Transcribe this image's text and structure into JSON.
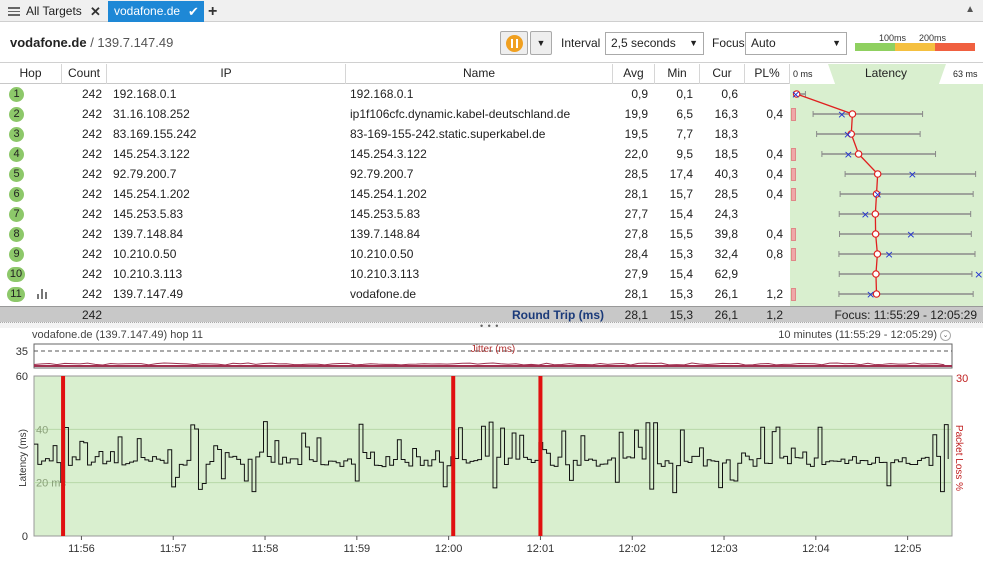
{
  "tabs": [
    {
      "label": "All Targets",
      "active": false
    },
    {
      "label": "vodafone.de",
      "active": true
    }
  ],
  "toolbar": {
    "host": "vodafone.de",
    "ip": "/ 139.7.147.49",
    "interval_label": "Interval",
    "interval_value": "2,5 seconds",
    "focus_label": "Focus",
    "focus_value": "Auto",
    "legend": [
      "100ms",
      "200ms"
    ],
    "colors": {
      "good": "#8fd060",
      "warn": "#f5c040",
      "bad": "#f06040"
    }
  },
  "table": {
    "headers": [
      "Hop",
      "Count",
      "IP",
      "Name",
      "Avg",
      "Min",
      "Cur",
      "PL%",
      "Latency"
    ],
    "latency_range": [
      "0 ms",
      "63 ms"
    ],
    "rows": [
      {
        "hop": "1",
        "count": "242",
        "ip": "192.168.0.1",
        "name": "192.168.0.1",
        "avg": "0,9",
        "min": "0,1",
        "cur": "0,6",
        "pl": ""
      },
      {
        "hop": "2",
        "count": "242",
        "ip": "31.16.108.252",
        "name": "ip1f106cfc.dynamic.kabel-deutschland.de",
        "avg": "19,9",
        "min": "6,5",
        "cur": "16,3",
        "pl": "0,4"
      },
      {
        "hop": "3",
        "count": "242",
        "ip": "83.169.155.242",
        "name": "83-169-155-242.static.superkabel.de",
        "avg": "19,5",
        "min": "7,7",
        "cur": "18,3",
        "pl": ""
      },
      {
        "hop": "4",
        "count": "242",
        "ip": "145.254.3.122",
        "name": "145.254.3.122",
        "avg": "22,0",
        "min": "9,5",
        "cur": "18,5",
        "pl": "0,4"
      },
      {
        "hop": "5",
        "count": "242",
        "ip": "92.79.200.7",
        "name": "92.79.200.7",
        "avg": "28,5",
        "min": "17,4",
        "cur": "40,3",
        "pl": "0,4"
      },
      {
        "hop": "6",
        "count": "242",
        "ip": "145.254.1.202",
        "name": "145.254.1.202",
        "avg": "28,1",
        "min": "15,7",
        "cur": "28,5",
        "pl": "0,4"
      },
      {
        "hop": "7",
        "count": "242",
        "ip": "145.253.5.83",
        "name": "145.253.5.83",
        "avg": "27,7",
        "min": "15,4",
        "cur": "24,3",
        "pl": ""
      },
      {
        "hop": "8",
        "count": "242",
        "ip": "139.7.148.84",
        "name": "139.7.148.84",
        "avg": "27,8",
        "min": "15,5",
        "cur": "39,8",
        "pl": "0,4"
      },
      {
        "hop": "9",
        "count": "242",
        "ip": "10.210.0.50",
        "name": "10.210.0.50",
        "avg": "28,4",
        "min": "15,3",
        "cur": "32,4",
        "pl": "0,8"
      },
      {
        "hop": "10",
        "count": "242",
        "ip": "10.210.3.113",
        "name": "10.210.3.113",
        "avg": "27,9",
        "min": "15,4",
        "cur": "62,9",
        "pl": ""
      },
      {
        "hop": "11",
        "count": "242",
        "ip": "139.7.147.49",
        "name": "vodafone.de",
        "avg": "28,1",
        "min": "15,3",
        "cur": "26,1",
        "pl": "1,2"
      }
    ],
    "footer": {
      "count": "242",
      "label": "Round Trip (ms)",
      "avg": "28,1",
      "min": "15,3",
      "cur": "26,1",
      "pl": "1,2",
      "focus": "Focus: 11:55:29 - 12:05:29"
    }
  },
  "graph": {
    "title": "vodafone.de (139.7.147.49) hop 11",
    "range": "10 minutes (11:55:29 - 12:05:29)",
    "jitter_label": "Jitter (ms)",
    "jitter_max": "35",
    "y_label": "Latency (ms)",
    "y2_label": "Packet Loss %",
    "y2_max": "30",
    "y_ticks": [
      "60",
      "40",
      "20 ms",
      "0"
    ],
    "x_ticks": [
      "11:56",
      "11:57",
      "11:58",
      "11:59",
      "12:00",
      "12:01",
      "12:02",
      "12:03",
      "12:04",
      "12:05"
    ],
    "loss_marker_times": [
      "11:55:48",
      "12:00:03",
      "12:01:00"
    ]
  },
  "chart_data": {
    "type": "line",
    "title": "vodafone.de (139.7.147.49) hop 11",
    "xlabel": "",
    "ylabel": "Latency (ms)",
    "ylim": [
      0,
      60
    ],
    "y2label": "Packet Loss %",
    "y2lim": [
      0,
      30
    ],
    "x": [
      "11:56",
      "11:57",
      "11:58",
      "11:59",
      "12:00",
      "12:01",
      "12:02",
      "12:03",
      "12:04",
      "12:05"
    ],
    "series": [
      {
        "name": "Latency (ms)",
        "values": [
          27,
          32,
          26,
          28,
          30,
          27,
          28,
          27,
          29,
          28
        ]
      }
    ]
  }
}
